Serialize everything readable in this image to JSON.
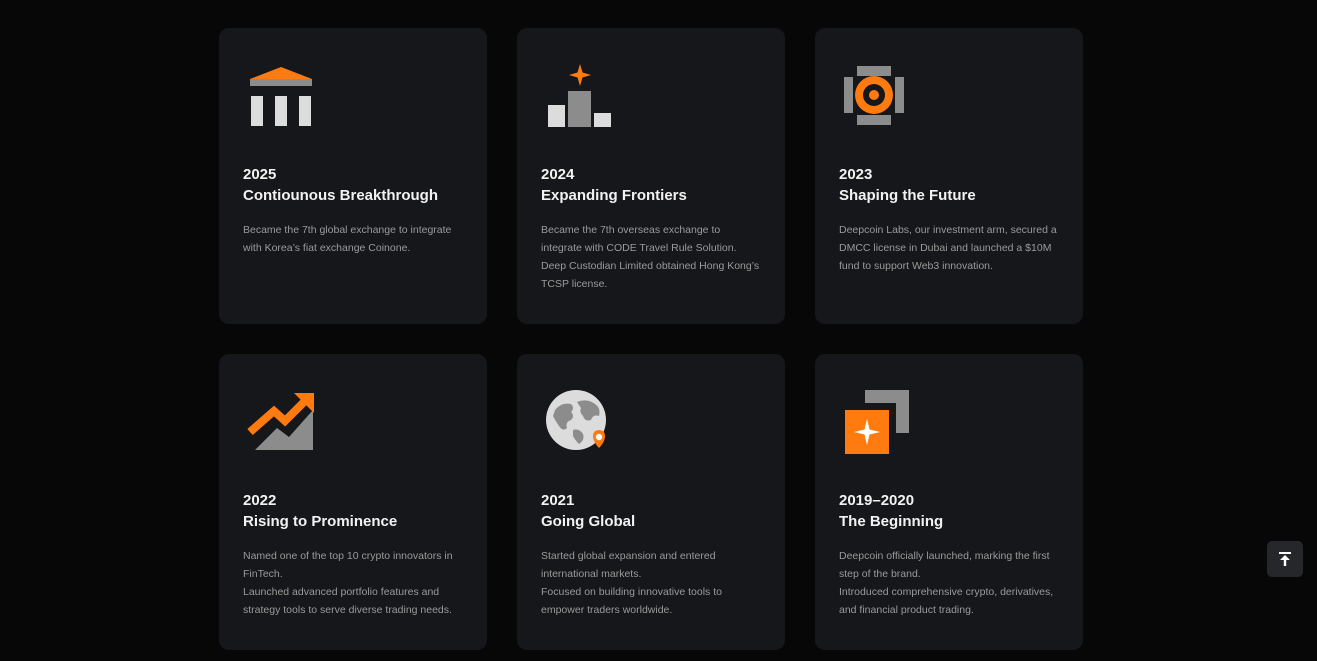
{
  "milestones": [
    {
      "year": "2025",
      "title": "Contiounous Breakthrough",
      "lines": [
        "Became the 7th global exchange to integrate with Korea’s fiat exchange Coinone."
      ],
      "icon": "bank-icon"
    },
    {
      "year": "2024",
      "title": "Expanding Frontiers",
      "lines": [
        "Became the 7th overseas exchange to integrate with CODE Travel Rule Solution.",
        "Deep Custodian Limited obtained Hong Kong’s TCSP license."
      ],
      "icon": "podium-star-icon"
    },
    {
      "year": "2023",
      "title": "Shaping the Future",
      "lines": [
        "Deepcoin Labs, our investment arm, secured a DMCC license in Dubai and launched a $10M fund to support Web3 innovation."
      ],
      "icon": "target-icon"
    },
    {
      "year": "2022",
      "title": "Rising to Prominence",
      "lines": [
        "Named one of the top 10 crypto innovators in FinTech.",
        "Launched advanced portfolio features and strategy tools to serve diverse trading needs."
      ],
      "icon": "trend-up-icon"
    },
    {
      "year": "2021",
      "title": "Going Global",
      "lines": [
        "Started global expansion and entered international markets.",
        "Focused on building innovative tools to empower traders worldwide."
      ],
      "icon": "globe-pin-icon"
    },
    {
      "year": "2019–2020",
      "title": "The Beginning",
      "lines": [
        "Deepcoin officially launched, marking the first step of the brand.",
        "Introduced comprehensive crypto, derivatives, and financial product trading."
      ],
      "icon": "corner-star-icon"
    }
  ],
  "colors": {
    "accent": "#ff7a0f",
    "card": "#16171a",
    "background": "#070707",
    "muted_icon": "#8c8c8c",
    "light_icon": "#dcdcdc"
  },
  "back_to_top": {
    "icon": "back-to-top-icon"
  }
}
